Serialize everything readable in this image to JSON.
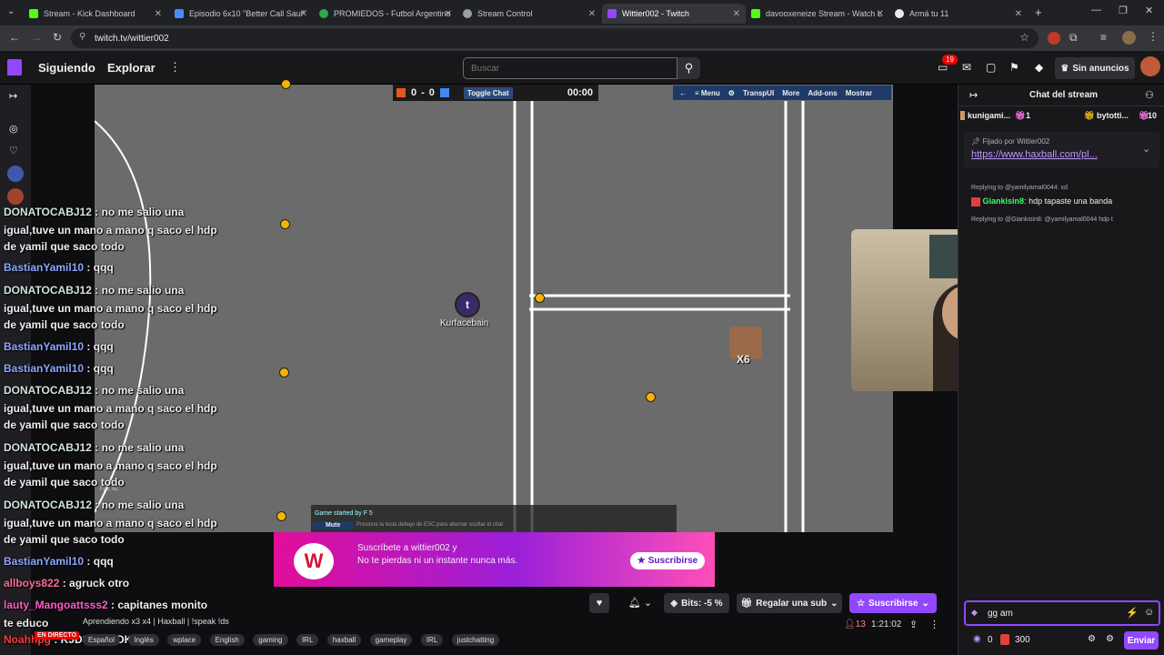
{
  "browser": {
    "tabs": [
      {
        "label": "Stream - Kick Dashboard",
        "color": "#53fc18"
      },
      {
        "label": "Episodio 6x10 \"Better Call Saul\"",
        "color": "#4a8cff"
      },
      {
        "label": "PROMIEDOS - Futbol Argentino",
        "color": "#2fa84f"
      },
      {
        "label": "Stream Control",
        "color": "#9aa0a6"
      },
      {
        "label": "Wittier002 - Twitch",
        "color": "#9147ff"
      },
      {
        "label": "davooxeneize Stream - Watch L",
        "color": "#53fc18"
      },
      {
        "label": "Armá tu 11",
        "color": "#e8eaed"
      }
    ],
    "url": "twitch.tv/wittier002"
  },
  "nav": {
    "following": "Siguiendo",
    "browse": "Explorar",
    "search_placeholder": "Buscar",
    "notif_count": "19",
    "ad_free": "Sin anuncios"
  },
  "game": {
    "score_red": "0",
    "score_sep": "-",
    "score_blue": "0",
    "toggle_chat": "Toggle Chat",
    "timer": "00:00",
    "menu_items": [
      "←",
      "≡ Menu",
      "⚙",
      "TranspUI",
      "More",
      "Add-ons",
      "Mostrar"
    ],
    "player_letter": "t",
    "player_name": "Kurfacebain",
    "player2": "X6",
    "started": "Game started by F 5",
    "mute": "Mute",
    "hint": "Presione la tecla debajo de ESC para alternar ocultar el chat",
    "fps": "Fps: 62"
  },
  "overlay_chat": [
    {
      "user": "DONATOCABJ12",
      "color": "#d2e4dc",
      "text": "no me salio una"
    },
    {
      "user": "",
      "color": "",
      "text": "igual,tuve un mano a mano q saco el hdp"
    },
    {
      "user": "",
      "color": "",
      "text": "de yamil que saco todo"
    },
    {
      "user": "BastianYamil10",
      "color": "#8ea7ff",
      "text": "qqq"
    },
    {
      "user": "DONATOCABJ12",
      "color": "#d2e4dc",
      "text": "no me salio una"
    },
    {
      "user": "",
      "color": "",
      "text": "igual,tuve un mano a mano q saco el hdp"
    },
    {
      "user": "",
      "color": "",
      "text": "de yamil que saco todo"
    },
    {
      "user": "BastianYamil10",
      "color": "#8ea7ff",
      "text": "qqq"
    },
    {
      "user": "BastianYamil10",
      "color": "#8ea7ff",
      "text": "qqq"
    },
    {
      "user": "DONATOCABJ12",
      "color": "#d2e4dc",
      "text": "no me salio una"
    },
    {
      "user": "",
      "color": "",
      "text": "igual,tuve un mano a mano q saco el hdp"
    },
    {
      "user": "",
      "color": "",
      "text": "de yamil que saco todo"
    },
    {
      "user": "DONATOCABJ12",
      "color": "#d2e4dc",
      "text": "no me salio una"
    },
    {
      "user": "",
      "color": "",
      "text": "igual,tuve un mano a mano q saco el hdp"
    },
    {
      "user": "",
      "color": "",
      "text": "de yamil que saco todo"
    },
    {
      "user": "DONATOCABJ12",
      "color": "#d2e4dc",
      "text": "no me salio una"
    },
    {
      "user": "",
      "color": "",
      "text": "igual,tuve un mano a mano q saco el hdp"
    },
    {
      "user": "",
      "color": "",
      "text": "de yamil que saco todo"
    },
    {
      "user": "BastianYamil10",
      "color": "#8ea7ff",
      "text": "qqq"
    },
    {
      "user": "allboys822",
      "color": "#ff6b9a",
      "text": "agruck otro"
    },
    {
      "user": "lauty_Mangoattsss2",
      "color": "#ff5bc8",
      "text": "capitanes monito"
    },
    {
      "user": "",
      "color": "",
      "text": "te educo"
    },
    {
      "user": "Noahhpg",
      "color": "#ff3a3a",
      "text": "KJDSLJFSDKLJ"
    }
  ],
  "sub_banner": {
    "line1": "Suscríbete a wittier002 y",
    "line2": "No te pierdas ni un instante nunca más.",
    "button": "Suscribirse",
    "logo": "W"
  },
  "stream_info": {
    "title_line": "Aprendiendo x3 x4 | Haxball | !speak !ds",
    "live": "EN DIRECTO",
    "lang": "Español",
    "lang2": "Inglés",
    "tags": [
      "wplace",
      "English",
      "gaming",
      "IRL",
      "haxball",
      "gameplay",
      "IRL",
      "justchatting"
    ],
    "bits": "Bits: -5 %",
    "gift": "Regalar una sub",
    "subscribe": "Suscribirse",
    "viewers": "13",
    "uptime": "1:21:02"
  },
  "chat": {
    "header": "Chat del stream",
    "top_gifters": [
      {
        "name": "kunigami...",
        "count": "1"
      },
      {
        "name": "bytotti...",
        "count": "10"
      }
    ],
    "pinned_by": "Fijado por",
    "pinned_user": "Wittier002",
    "pinned_link": "https://www.haxball.com/pl...",
    "messages": [
      {
        "reply": "Replying to @yamilyamal0044: xd",
        "user": "Giankisin8",
        "color": "#3aff6a",
        "text": "hdp tapaste una banda"
      },
      {
        "reply": "Replying to @Giankisin8: @yamilyamal0044 hdp t",
        "user": "",
        "color": "",
        "text": ""
      }
    ],
    "input_value": "gg am",
    "points": "0",
    "bits": "300",
    "send": "Enviar"
  }
}
